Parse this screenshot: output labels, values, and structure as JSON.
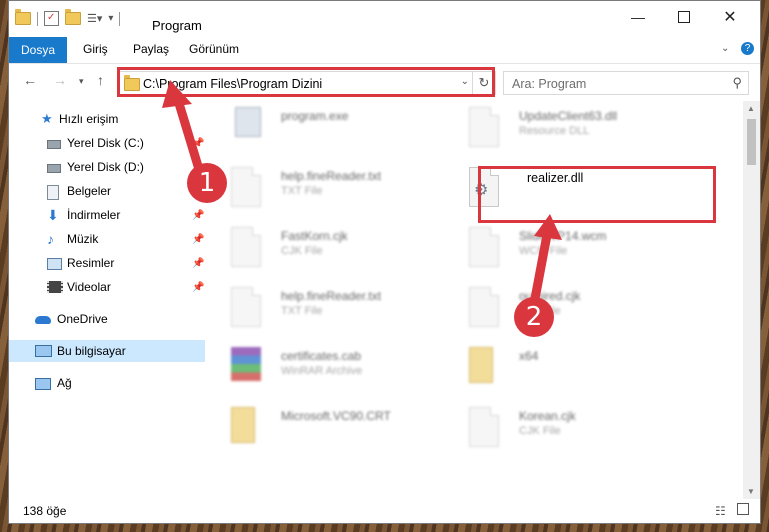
{
  "window": {
    "title": "Program",
    "controls": {
      "minimize_icon": "minimize-icon",
      "maximize_icon": "maximize-icon",
      "close_icon": "close-icon"
    }
  },
  "ribbon": {
    "tabs": [
      {
        "label": "Dosya"
      },
      {
        "label": "Giriş"
      },
      {
        "label": "Paylaş"
      },
      {
        "label": "Görünüm"
      }
    ]
  },
  "address": {
    "path": "C:\\Program Files\\Program Dizini"
  },
  "search": {
    "placeholder": "Ara: Program"
  },
  "sidebar": {
    "items": [
      {
        "label": "Hızlı erişim",
        "icon": "star-icon"
      },
      {
        "label": "Yerel Disk (C:)",
        "icon": "drive-icon"
      },
      {
        "label": "Yerel Disk (D:)",
        "icon": "drive-icon"
      },
      {
        "label": "Belgeler",
        "icon": "documents-icon"
      },
      {
        "label": "İndirmeler",
        "icon": "download-icon"
      },
      {
        "label": "Müzik",
        "icon": "music-icon"
      },
      {
        "label": "Resimler",
        "icon": "pictures-icon"
      },
      {
        "label": "Videolar",
        "icon": "video-icon"
      },
      {
        "label": "OneDrive",
        "icon": "cloud-icon"
      },
      {
        "label": "Bu bilgisayar",
        "icon": "computer-icon"
      },
      {
        "label": "Ağ",
        "icon": "network-icon"
      }
    ]
  },
  "files": [
    {
      "name": "program.exe",
      "type": ""
    },
    {
      "name": "UpdateClient63.dll",
      "type": "Resource DLL"
    },
    {
      "name": "help.fineReader.txt",
      "type": "TXT File"
    },
    {
      "name": "realizer.dll",
      "type": ""
    },
    {
      "name": "FastKorn.cjk",
      "type": "CJK File"
    },
    {
      "name": "SlideWP14.wcm",
      "type": "WCM File"
    },
    {
      "name": "help.fineReader.txt",
      "type": "TXT File"
    },
    {
      "name": "outhired.cjk",
      "type": "CJK File"
    },
    {
      "name": "certificates.cab",
      "type": "WinRAR Archive"
    },
    {
      "name": "x64",
      "type": ""
    },
    {
      "name": "Microsoft.VC90.CRT",
      "type": ""
    },
    {
      "name": "Korean.cjk",
      "type": "CJK File"
    }
  ],
  "status": {
    "count": "138 öğe"
  },
  "annotations": {
    "step1": "1",
    "step2": "2",
    "color": "#d9363e"
  }
}
